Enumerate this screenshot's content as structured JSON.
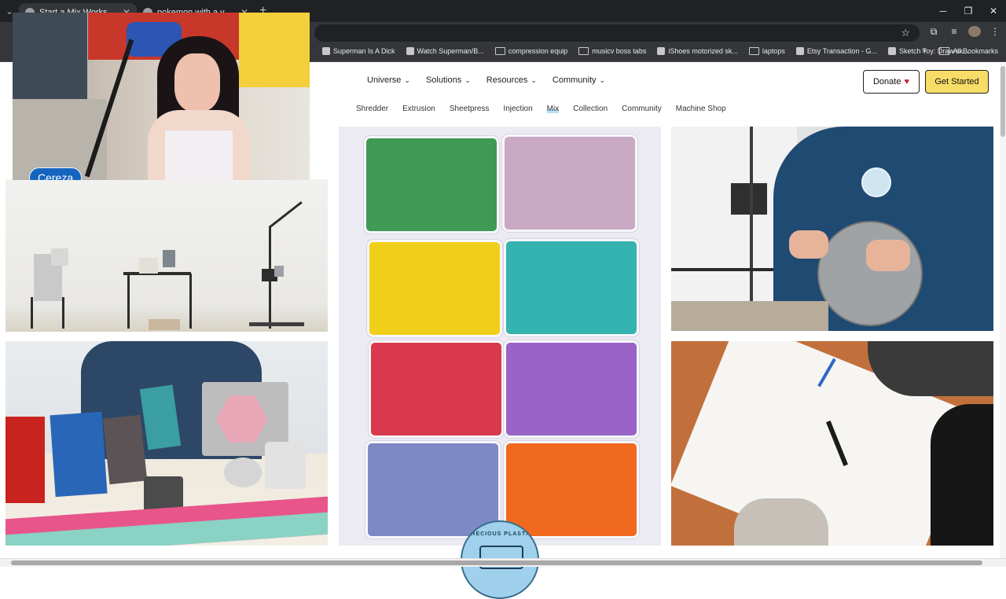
{
  "browser": {
    "tabs": [
      {
        "title": "Start a Mix Workspace to Recy",
        "active": true
      },
      {
        "title": "pokemon with a volcano on its",
        "active": false
      }
    ],
    "bookmarks": [
      {
        "label": "Superman Is A Dick",
        "type": "page"
      },
      {
        "label": "Watch Superman/B...",
        "type": "page"
      },
      {
        "label": "compression equip",
        "type": "folder"
      },
      {
        "label": "musicv boss tabs",
        "type": "folder"
      },
      {
        "label": "iShoes motorized sk...",
        "type": "page"
      },
      {
        "label": "laptops",
        "type": "folder"
      },
      {
        "label": "Etsy Transaction - G...",
        "type": "page"
      },
      {
        "label": "Sketch Toy: Draw sk...",
        "type": "page"
      }
    ],
    "all_bookmarks": "All Bookmarks"
  },
  "site": {
    "nav": [
      "Universe",
      "Solutions",
      "Resources",
      "Community"
    ],
    "donate_label": "Donate",
    "get_started_label": "Get Started",
    "subnav": [
      "Shredder",
      "Extrusion",
      "Sheetpress",
      "Injection",
      "Mix",
      "Collection",
      "Community",
      "Machine Shop"
    ],
    "subnav_active": "Mix",
    "logo_text": "PRECIOUS PLASTIC"
  },
  "webcam": {
    "name": "Cereza"
  },
  "colors": {
    "bins": [
      "#3f9a55",
      "#c9a9c4",
      "#f0cf1a",
      "#35b3b0",
      "#d9394c",
      "#9a63c8",
      "#7c89c4",
      "#f0691e"
    ],
    "accent_yellow": "#f7dc67",
    "cam_label": "#1565c0"
  }
}
